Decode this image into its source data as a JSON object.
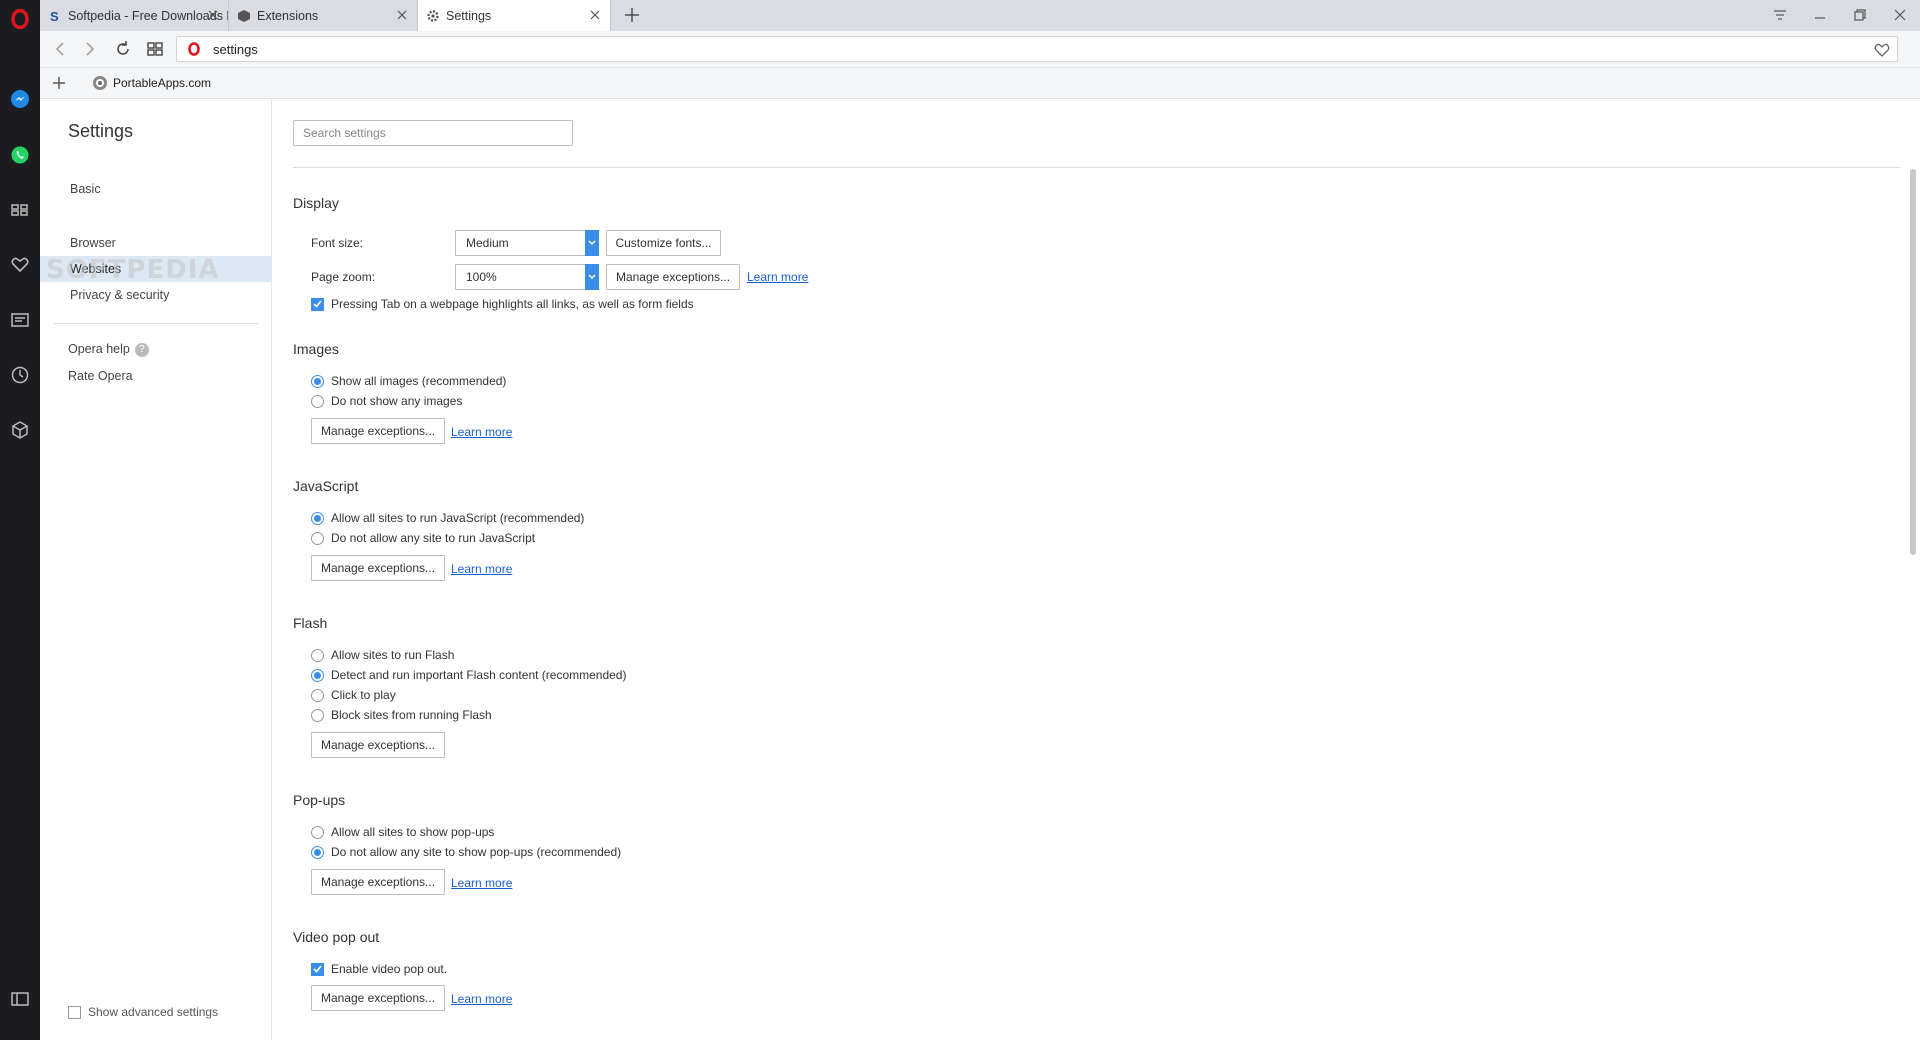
{
  "tabs": [
    {
      "title": "Softpedia - Free Downloads Encyclopedia",
      "icon": "softpedia-icon"
    },
    {
      "title": "Extensions",
      "icon": "extensions-cube-icon"
    },
    {
      "title": "Settings",
      "icon": "gear-icon"
    }
  ],
  "address": {
    "url": "settings"
  },
  "bookmarks": [
    {
      "label": "PortableApps.com",
      "icon": "portableapps-icon"
    }
  ],
  "sidebar_icons": [
    "opera-logo-icon",
    "messenger-icon",
    "whatsapp-icon",
    "speed-dial-icon",
    "heart-icon",
    "news-icon",
    "history-clock-icon",
    "extensions-cube-icon",
    "sidebar-toggle-icon"
  ],
  "nav": {
    "title": "Settings",
    "items": [
      "Basic",
      "Browser",
      "Websites",
      "Privacy & security"
    ],
    "selected": "Websites",
    "help": "Opera help",
    "rate": "Rate Opera",
    "advanced": "Show advanced settings"
  },
  "search": {
    "placeholder": "Search settings"
  },
  "display": {
    "title": "Display",
    "font_size_label": "Font size:",
    "font_size_value": "Medium",
    "customize_fonts": "Customize fonts...",
    "page_zoom_label": "Page zoom:",
    "page_zoom_value": "100%",
    "manage_exceptions": "Manage exceptions...",
    "learn_more": "Learn more",
    "tab_highlight": "Pressing Tab on a webpage highlights all links, as well as form fields"
  },
  "images": {
    "title": "Images",
    "options": [
      "Show all images (recommended)",
      "Do not show any images"
    ],
    "manage_exceptions": "Manage exceptions...",
    "learn_more": "Learn more"
  },
  "javascript": {
    "title": "JavaScript",
    "options": [
      "Allow all sites to run JavaScript (recommended)",
      "Do not allow any site to run JavaScript"
    ],
    "manage_exceptions": "Manage exceptions...",
    "learn_more": "Learn more"
  },
  "flash": {
    "title": "Flash",
    "options": [
      "Allow sites to run Flash",
      "Detect and run important Flash content (recommended)",
      "Click to play",
      "Block sites from running Flash"
    ],
    "manage_exceptions": "Manage exceptions..."
  },
  "popups": {
    "title": "Pop-ups",
    "options": [
      "Allow all sites to show pop-ups",
      "Do not allow any site to show pop-ups (recommended)"
    ],
    "manage_exceptions": "Manage exceptions...",
    "learn_more": "Learn more"
  },
  "video": {
    "title": "Video pop out",
    "enable": "Enable video pop out.",
    "manage_exceptions": "Manage exceptions...",
    "learn_more": "Learn more"
  },
  "watermark": "SOFTPEDIA",
  "colors": {
    "accent": "#3b8ee8",
    "opera_red": "#e0141c",
    "sidebar": "#1c1c20"
  }
}
